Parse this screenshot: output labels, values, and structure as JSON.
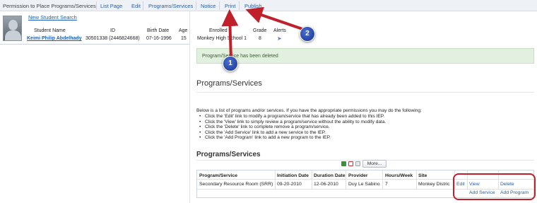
{
  "nav": {
    "items": [
      "Permission to Place Programs/Services",
      "List Page",
      "Edit",
      "Programs/Services",
      "Notice",
      "Print",
      "Publish"
    ]
  },
  "student": {
    "new_search": "New Student Search",
    "headers": [
      "Student Name",
      "ID",
      "Birth Date",
      "Age",
      "Enrolled",
      "Grade",
      "Alerts"
    ],
    "name": "Keimi Philip Abdelhady",
    "id": "30501338 (2446824668)",
    "birth_date": "07-16-1996",
    "age": "15",
    "enrolled": "Monkey High School 1",
    "grade": "8",
    "alerts_icon": "pin-icon"
  },
  "message": "Program/Service has been deleted",
  "page_title": "Programs/Services",
  "intro": "Below is a list of programs and/or services. If you have the appropriate permissions you may do the following:",
  "bullets": [
    "Click the 'Edit' link to modify a program/service that has already been added to this IEP.",
    "Click the 'View' link to simply review a program/service without the ability to modify data.",
    "Click the 'Delete' link to complete remove a program/service.",
    "Click the 'Add Service' link to add a new service to the IEP.",
    "Click the 'Add Program' link to add a new program to the IEP."
  ],
  "section_title": "Programs/Services",
  "more_button": "More...",
  "export_icons": [
    "excel-icon",
    "pdf-icon",
    "document-icon"
  ],
  "table": {
    "columns": [
      "Program/Service",
      "Initiation Date",
      "Duration Date",
      "Provider",
      "Hours/Week",
      "Site"
    ],
    "rows": [
      [
        "Secondary Resource Room (SRR)",
        "09-20-2010",
        "12-06-2010",
        "Duy Le Sabino",
        "7",
        "Monkey Distric"
      ]
    ],
    "actions": {
      "edit": "Edit",
      "view": "View",
      "delete": "Delete",
      "add_service": "Add Service",
      "add_program": "Add Program"
    }
  },
  "annotations": {
    "badge_1": "1",
    "badge_2": "2",
    "color": "#c0202a"
  }
}
